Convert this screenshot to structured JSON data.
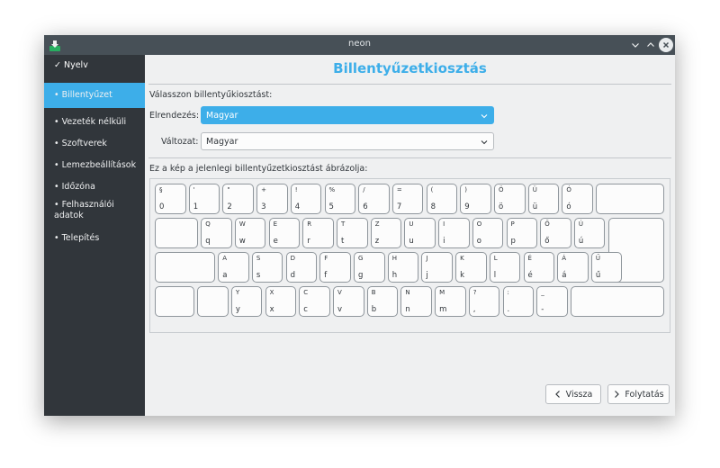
{
  "window": {
    "title": "neon"
  },
  "sidebar": {
    "items": [
      {
        "label": "✓ Nyelv",
        "state": "done"
      },
      {
        "label": "• Billentyűzet",
        "state": "active"
      },
      {
        "label": "• Vezeték nélküli",
        "state": "todo"
      },
      {
        "label": "• Szoftverek",
        "state": "todo"
      },
      {
        "label": "• Lemezbeállítások",
        "state": "todo"
      },
      {
        "label": "• Időzóna",
        "state": "todo"
      },
      {
        "label": "• Felhasználói adatok",
        "state": "todo"
      },
      {
        "label": "• Telepítés",
        "state": "todo"
      }
    ]
  },
  "page": {
    "title": "Billentyűzetkiosztás",
    "choose_label": "Válasszon billentyűkiosztást:",
    "layout_label": "Elrendezés:",
    "layout_value": "Magyar",
    "variant_label": "Változat:",
    "variant_value": "Magyar",
    "image_label": "Ez a kép a jelenlegi billentyűzetkiosztást ábrázolja:"
  },
  "keyboard": {
    "rows": [
      {
        "lead": null,
        "keys": [
          [
            "§",
            "0"
          ],
          [
            "'",
            "1"
          ],
          [
            "\"",
            "2"
          ],
          [
            "+",
            "3"
          ],
          [
            "!",
            "4"
          ],
          [
            "%",
            "5"
          ],
          [
            "/",
            "6"
          ],
          [
            "=",
            "7"
          ],
          [
            "(",
            "8"
          ],
          [
            ")",
            "9"
          ],
          [
            "Ö",
            "ö"
          ],
          [
            "Ü",
            "ü"
          ],
          [
            "Ó",
            "ó"
          ]
        ],
        "trail": "backspace"
      },
      {
        "lead": "tab",
        "keys": [
          [
            "Q",
            "q"
          ],
          [
            "W",
            "w"
          ],
          [
            "E",
            "e"
          ],
          [
            "R",
            "r"
          ],
          [
            "T",
            "t"
          ],
          [
            "Z",
            "z"
          ],
          [
            "U",
            "u"
          ],
          [
            "I",
            "i"
          ],
          [
            "O",
            "o"
          ],
          [
            "P",
            "p"
          ],
          [
            "Ő",
            "ő"
          ],
          [
            "Ú",
            "ú"
          ]
        ],
        "trail": "enter"
      },
      {
        "lead": "caps",
        "keys": [
          [
            "A",
            "a"
          ],
          [
            "S",
            "s"
          ],
          [
            "D",
            "d"
          ],
          [
            "F",
            "f"
          ],
          [
            "G",
            "g"
          ],
          [
            "H",
            "h"
          ],
          [
            "J",
            "j"
          ],
          [
            "K",
            "k"
          ],
          [
            "L",
            "l"
          ],
          [
            "É",
            "é"
          ],
          [
            "Á",
            "á"
          ],
          [
            "Ű",
            "ű"
          ]
        ],
        "trail": null
      },
      {
        "lead": "lshift",
        "keys": [
          [
            "",
            ""
          ],
          [
            "Y",
            "y"
          ],
          [
            "X",
            "x"
          ],
          [
            "C",
            "c"
          ],
          [
            "V",
            "v"
          ],
          [
            "B",
            "b"
          ],
          [
            "N",
            "n"
          ],
          [
            "M",
            "m"
          ],
          [
            "?",
            ","
          ],
          [
            ":",
            "."
          ],
          [
            "_",
            "-"
          ]
        ],
        "trail": "rshift"
      }
    ]
  },
  "buttons": {
    "back_label": "Vissza",
    "next_label": "Folytatás"
  },
  "colors": {
    "accent": "#3daee9",
    "sidebar_bg": "#31363b",
    "titlebar_bg": "#475057",
    "window_bg": "#eff0f1"
  },
  "icons": {
    "app": "installer-icon",
    "minimize": "chevron-down-icon",
    "maximize": "chevron-up-icon",
    "close": "close-icon",
    "back": "chevron-left-icon",
    "next": "chevron-right-icon"
  }
}
